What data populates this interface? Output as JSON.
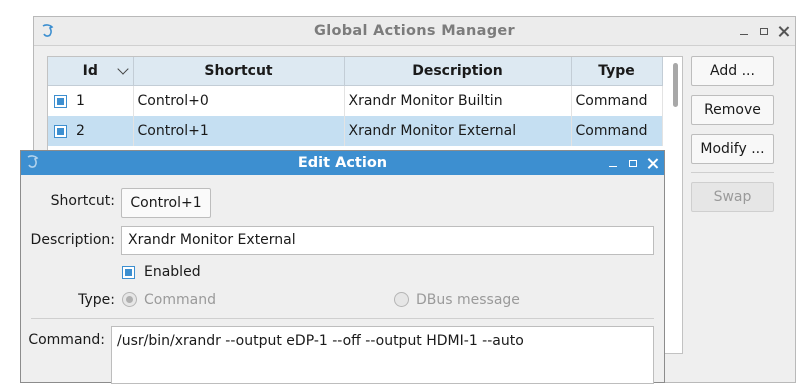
{
  "main_window": {
    "title": "Global Actions Manager",
    "table": {
      "columns": [
        "Id",
        "Shortcut",
        "Description",
        "Type"
      ],
      "rows": [
        {
          "id": "1",
          "shortcut": "Control+0",
          "description": "Xrandr Monitor Builtin",
          "type": "Command",
          "enabled": true,
          "selected": false
        },
        {
          "id": "2",
          "shortcut": "Control+1",
          "description": "Xrandr Monitor External",
          "type": "Command",
          "enabled": true,
          "selected": true
        }
      ]
    },
    "buttons": {
      "add": "Add ...",
      "remove": "Remove",
      "modify": "Modify ...",
      "swap": "Swap"
    }
  },
  "dialog": {
    "title": "Edit Action",
    "shortcut_label": "Shortcut:",
    "shortcut_value": "Control+1",
    "description_label": "Description:",
    "description_value": "Xrandr Monitor External",
    "enabled_label": "Enabled",
    "enabled": true,
    "type_label": "Type:",
    "type_options": [
      "Command",
      "DBus message"
    ],
    "type_selected": "Command",
    "command_label": "Command:",
    "command_value": "/usr/bin/xrandr --output eDP-1 --off --output HDMI-1 --auto"
  },
  "colors": {
    "accent": "#3d8fd0",
    "selected_row": "#c5dff2",
    "header_bg": "#dde9f2"
  }
}
